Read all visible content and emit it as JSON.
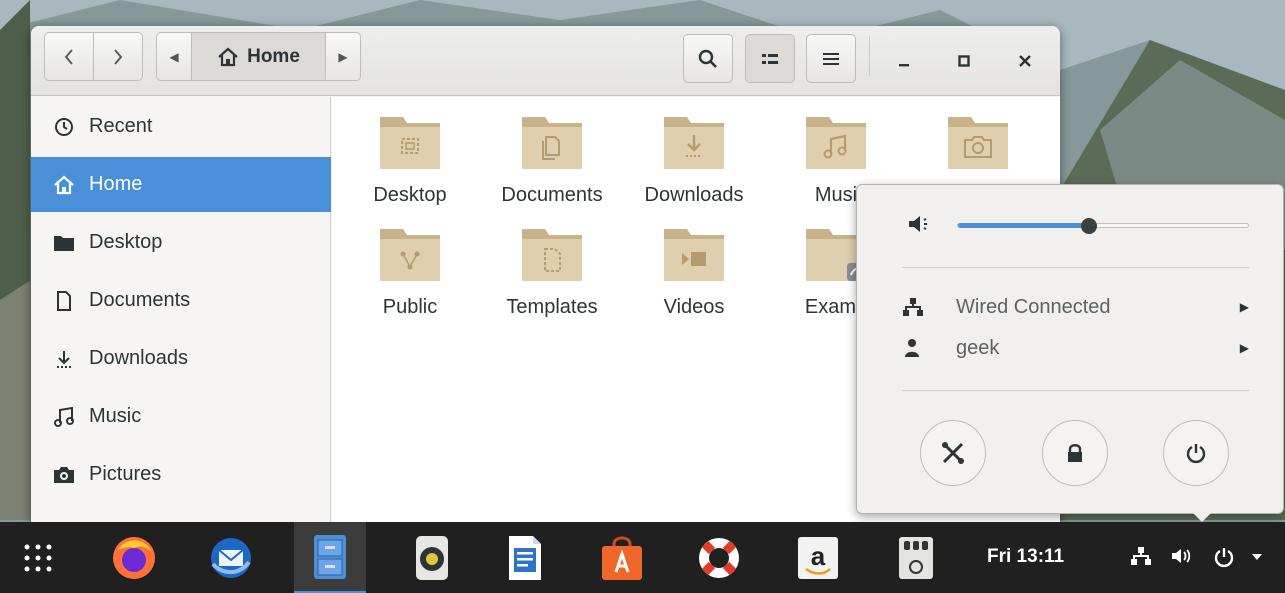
{
  "window": {
    "path_label": "Home"
  },
  "sidebar": {
    "items": [
      {
        "label": "Recent",
        "icon": "clock-icon"
      },
      {
        "label": "Home",
        "icon": "home-icon",
        "active": true
      },
      {
        "label": "Desktop",
        "icon": "folder-icon"
      },
      {
        "label": "Documents",
        "icon": "document-icon"
      },
      {
        "label": "Downloads",
        "icon": "download-icon"
      },
      {
        "label": "Music",
        "icon": "music-icon"
      },
      {
        "label": "Pictures",
        "icon": "camera-icon"
      }
    ]
  },
  "files": [
    {
      "label": "Desktop",
      "emblem": "desktop-emblem"
    },
    {
      "label": "Documents",
      "emblem": "documents-emblem"
    },
    {
      "label": "Downloads",
      "emblem": "download-emblem"
    },
    {
      "label": "Musi",
      "emblem": "music-emblem"
    },
    {
      "label": "",
      "emblem": "camera-emblem"
    },
    {
      "label": "Public",
      "emblem": "share-emblem"
    },
    {
      "label": "Templates",
      "emblem": "template-emblem"
    },
    {
      "label": "Videos",
      "emblem": "video-emblem"
    },
    {
      "label": "Examp",
      "emblem": "link-emblem"
    }
  ],
  "system_menu": {
    "volume_fraction": 0.45,
    "network_label": "Wired Connected",
    "user_label": "geek"
  },
  "taskbar": {
    "clock": "Fri 13:11",
    "apps": [
      "app-grid",
      "firefox",
      "thunderbird",
      "files",
      "rhythmbox",
      "writer",
      "software-center",
      "help",
      "amazon",
      "system-tools"
    ]
  },
  "colors": {
    "accent": "#4a90d9",
    "folder": "#d6c4a0",
    "taskbar": "#202020"
  }
}
